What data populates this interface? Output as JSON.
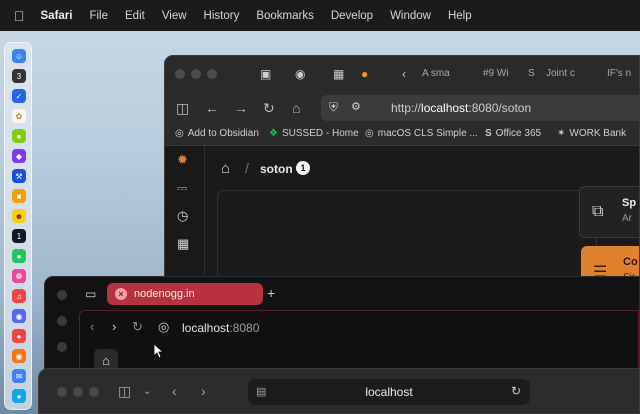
{
  "menubar": {
    "app": "Safari",
    "items": [
      "File",
      "Edit",
      "View",
      "History",
      "Bookmarks",
      "Develop",
      "Window",
      "Help"
    ]
  },
  "back_window": {
    "tabs": [
      "A sma",
      "#9 Wi",
      "Joint c",
      "IF's n"
    ],
    "url_prefix": "http://",
    "url_host": "localhost",
    "url_rest": ":8080/soton",
    "bookmarks": [
      "Add to Obsidian",
      "SUSSED - Home",
      "macOS CLS Simple ...",
      "Office 365",
      "WORK Bank"
    ],
    "breadcrumb_title": "soton",
    "badge": "1",
    "card1": {
      "title": "Sp",
      "sub": "Ar"
    },
    "card2": {
      "title": "Co",
      "sub": "Sir"
    }
  },
  "mid_window": {
    "tab_title": "nodenogg.in",
    "url_host": "localhost",
    "url_port": ":8080"
  },
  "front_window": {
    "address": "localhost"
  },
  "colors": {
    "accent_orange": "#e0812f",
    "tab_red": "#b5323e"
  }
}
